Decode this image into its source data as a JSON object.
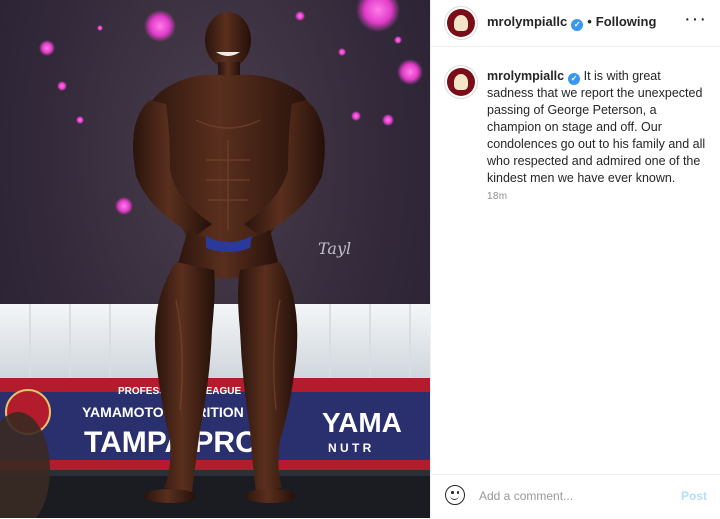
{
  "post": {
    "username": "mrolympiallc",
    "verified_icon": "verified-badge-icon",
    "separator": "•",
    "follow_status": "Following",
    "more_label": "···",
    "caption_username": "mrolympiallc",
    "caption_text": "It is with great sadness that we report the unexpected passing of George Peterson, a champion on stage and off. Our condolences go out to his family and all who respected and admired one of the kindest men we have ever known.",
    "timestamp": "18m",
    "comment_placeholder": "Add a comment...",
    "post_label": "Post"
  },
  "photo": {
    "banner_small_text": "PROFESSIONAL LEAGUE",
    "banner_line2": "YAMAMOTO NUTRITION CUP",
    "banner_big_left": "TAMPA PRO",
    "banner_big_right": "YAMA",
    "banner_sub_right": "N U T R",
    "signature": "Tayl"
  },
  "colors": {
    "verified": "#3897f0",
    "post_disabled": "#b2dffc",
    "banner_red": "#b31c2c",
    "banner_blue": "#2a2f6e"
  }
}
